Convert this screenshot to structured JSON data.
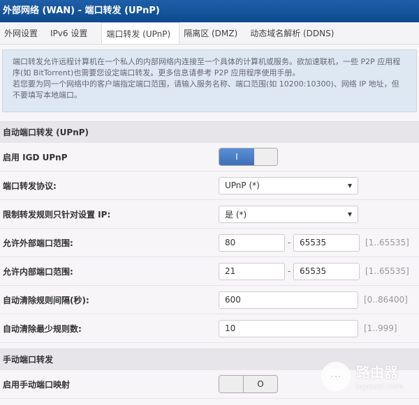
{
  "title": "外部网络 (WAN) - 端口转发 (UPnP)",
  "tabs": [
    "外网设置",
    "IPv6 设置",
    "端口转发 (UPnP)",
    "隔离区 (DMZ)",
    "动态域名解析 (DDNS)"
  ],
  "info": [
    "端口转发允许远程计算机在一个私人的内部网络内连接至一个具体的计算机或服务。欲加速联机，一些 P2P 应用程序(如 BitTorrent)也需要您设定端口转发。更多信息请参考 P2P 应用程序使用手册。",
    "若您要为同一个网络中的客户端指定端口范围，请输入服务名称、端口范围(如 10200:10300)、网络 IP 地址，但不要填写本地端口。"
  ],
  "section1": "自动端口转发 (UPnP)",
  "rows": {
    "igd": {
      "label": "启用 IGD UPnP",
      "on": "I",
      "value": true
    },
    "protocol": {
      "label": "端口转发协议:",
      "value": "UPnP (*)"
    },
    "restrict": {
      "label": "限制转发规则只针对设置 IP:",
      "value": "是 (*)"
    },
    "ext": {
      "label": "允许外部端口范围:",
      "from": "80",
      "to": "65535",
      "hint": "[1..65535]"
    },
    "int": {
      "label": "允许内部端口范围:",
      "from": "21",
      "to": "65535",
      "hint": "[1..65535]"
    },
    "interval": {
      "label": "自动清除规则间隔(秒):",
      "value": "600",
      "hint": "[0..86400]"
    },
    "min": {
      "label": "自动清除最少规则数:",
      "value": "10",
      "hint": "[1..999]"
    }
  },
  "section2": "手动端口转发",
  "manual": {
    "label": "启用手动端口映射",
    "off": "O",
    "value": false
  },
  "watermark": {
    "name": "路由器",
    "url": "luyouqi.com"
  }
}
